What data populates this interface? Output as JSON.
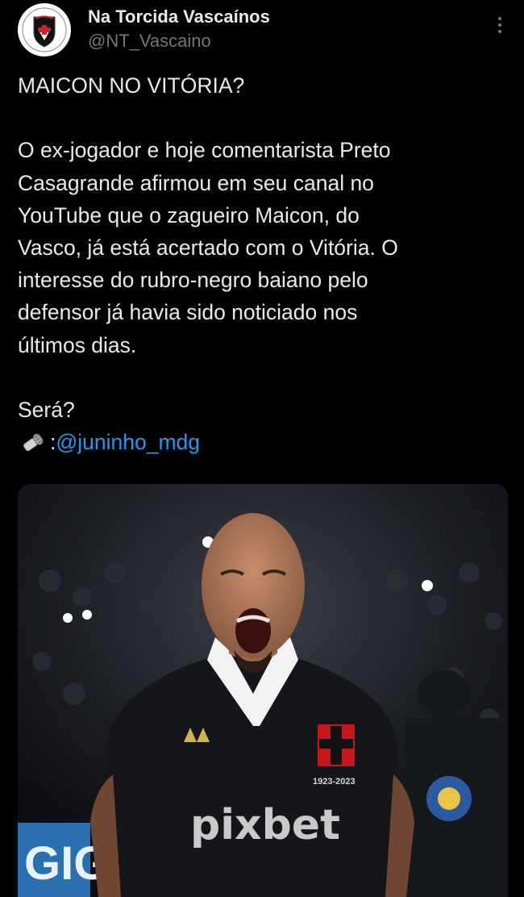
{
  "author": {
    "display_name": "Na Torcida Vascaínos",
    "handle": "@NT_Vascaino",
    "avatar_icon": "vasco-crest-icon"
  },
  "tweet": {
    "headline": "MAICON NO VITÓRIA?",
    "body": "O ex-jogador e hoje comentarista Preto\nCasagrande afirmou em seu canal no\nYouTube que o zagueiro Maicon, do\nVasco, já está acertado com o Vitória.   O\ninteresse do rubro-negro baiano pelo\ndefensor já havia sido noticiado nos\núltimos dias.",
    "closing": "Será?",
    "credit_icon": "microphone-icon",
    "credit_separator": ":",
    "credit_mention": "@juninho_mdg"
  },
  "photo": {
    "sponsor_text": "pixbet",
    "badge_text": "1923-2023",
    "brand": "Kappa"
  },
  "colors": {
    "background": "#000000",
    "text": "#e7e9ea",
    "secondary": "#71767b",
    "link": "#1d9bf0"
  }
}
